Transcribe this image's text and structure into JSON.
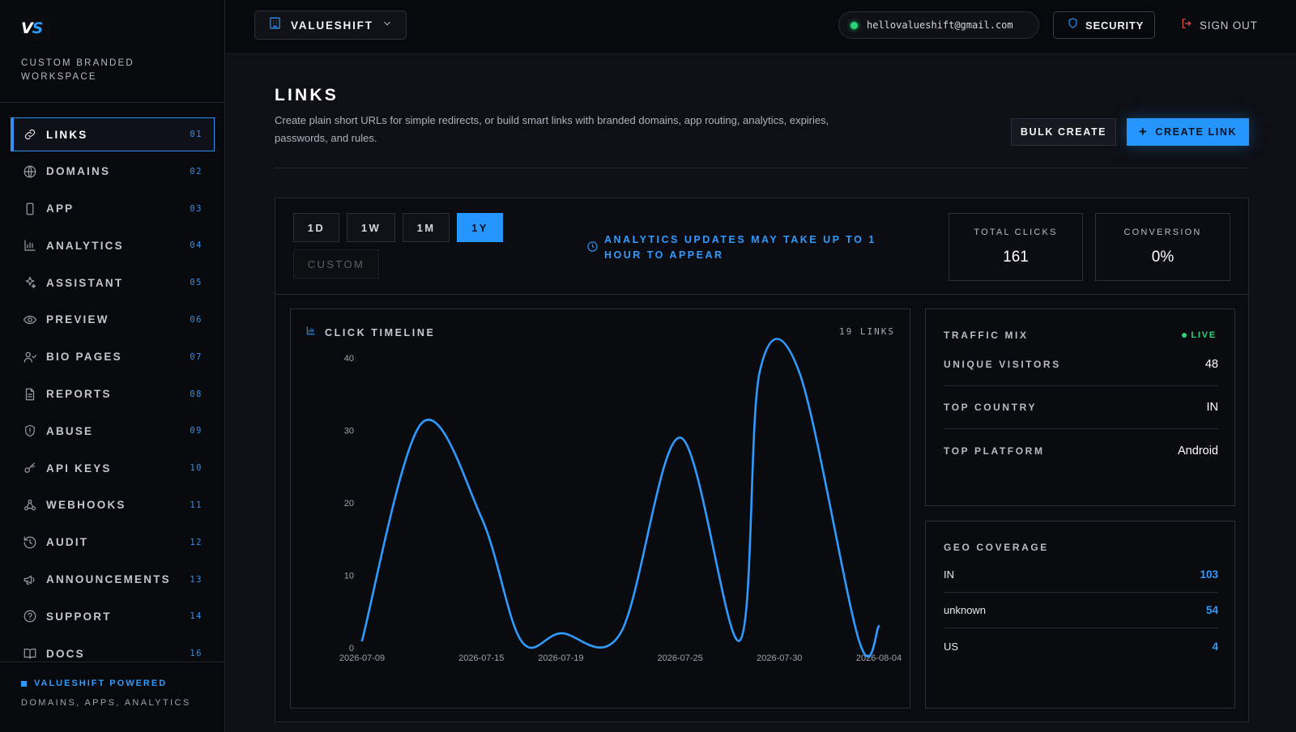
{
  "brand": {
    "logo_v": "V",
    "logo_s": "S",
    "tagline": "CUSTOM BRANDED WORKSPACE"
  },
  "sidebar": {
    "items": [
      {
        "label": "LINKS",
        "num": "01",
        "icon": "link-icon",
        "active": true
      },
      {
        "label": "DOMAINS",
        "num": "02",
        "icon": "globe-icon"
      },
      {
        "label": "APP",
        "num": "03",
        "icon": "phone-icon"
      },
      {
        "label": "ANALYTICS",
        "num": "04",
        "icon": "bar-chart-icon"
      },
      {
        "label": "ASSISTANT",
        "num": "05",
        "icon": "sparkles-icon"
      },
      {
        "label": "PREVIEW",
        "num": "06",
        "icon": "eye-icon"
      },
      {
        "label": "BIO PAGES",
        "num": "07",
        "icon": "user-check-icon"
      },
      {
        "label": "REPORTS",
        "num": "08",
        "icon": "file-text-icon"
      },
      {
        "label": "ABUSE",
        "num": "09",
        "icon": "shield-alert-icon"
      },
      {
        "label": "API KEYS",
        "num": "10",
        "icon": "key-icon"
      },
      {
        "label": "WEBHOOKS",
        "num": "11",
        "icon": "webhook-icon"
      },
      {
        "label": "AUDIT",
        "num": "12",
        "icon": "history-icon"
      },
      {
        "label": "ANNOUNCEMENTS",
        "num": "13",
        "icon": "megaphone-icon"
      },
      {
        "label": "SUPPORT",
        "num": "14",
        "icon": "help-circle-icon"
      },
      {
        "label": "DOCS",
        "num": "16",
        "icon": "book-icon"
      }
    ],
    "footer_title": "VALUESHIFT POWERED",
    "footer_sub": "DOMAINS, APPS, ANALYTICS"
  },
  "topbar": {
    "workspace": "VALUESHIFT",
    "email": "hellovalueshift@gmail.com",
    "security": "SECURITY",
    "signout": "SIGN OUT"
  },
  "page": {
    "title": "LINKS",
    "description": "Create plain short URLs for simple redirects, or build smart links with branded domains, app routing, analytics, expiries, passwords, and rules.",
    "bulk_create": "BULK CREATE",
    "create_link": "CREATE LINK"
  },
  "ranges": {
    "d1": "1D",
    "w1": "1W",
    "m1": "1M",
    "y1": "1Y",
    "custom": "CUSTOM",
    "selected": "1Y"
  },
  "notice": "ANALYTICS UPDATES MAY TAKE UP TO 1 HOUR TO APPEAR",
  "stats": {
    "total_clicks_label": "TOTAL CLICKS",
    "total_clicks": "161",
    "conversion_label": "CONVERSION",
    "conversion": "0%"
  },
  "timeline": {
    "title": "CLICK TIMELINE",
    "links": "19 LINKS"
  },
  "traffic": {
    "title": "TRAFFIC MIX",
    "live": "LIVE",
    "rows": [
      {
        "label": "UNIQUE VISITORS",
        "value": "48"
      },
      {
        "label": "TOP COUNTRY",
        "value": "IN"
      },
      {
        "label": "TOP PLATFORM",
        "value": "Android"
      }
    ]
  },
  "geo": {
    "title": "GEO COVERAGE",
    "rows": [
      {
        "label": "IN",
        "value": "103"
      },
      {
        "label": "unknown",
        "value": "54"
      },
      {
        "label": "US",
        "value": "4"
      }
    ]
  },
  "colors": {
    "accent": "#2595ff",
    "live": "#2bd47a",
    "danger": "#f04b4b"
  },
  "chart_data": {
    "type": "line",
    "title": "CLICK TIMELINE",
    "xlabel": "",
    "ylabel": "",
    "ylim": [
      0,
      40
    ],
    "yticks": [
      0,
      10,
      20,
      30,
      40
    ],
    "xticks": [
      "2026-07-09",
      "2026-07-15",
      "2026-07-19",
      "2026-07-25",
      "2026-07-30",
      "2026-08-04"
    ],
    "x": [
      "2026-07-09",
      "2026-07-12",
      "2026-07-15",
      "2026-07-17",
      "2026-07-19",
      "2026-07-22",
      "2026-07-25",
      "2026-07-28",
      "2026-07-29",
      "2026-07-31",
      "2026-08-03",
      "2026-08-04"
    ],
    "values": [
      1,
      31,
      18,
      1,
      2,
      2,
      29,
      1,
      38,
      38,
      1,
      3
    ],
    "grid": false,
    "color": "#2f9bff"
  }
}
